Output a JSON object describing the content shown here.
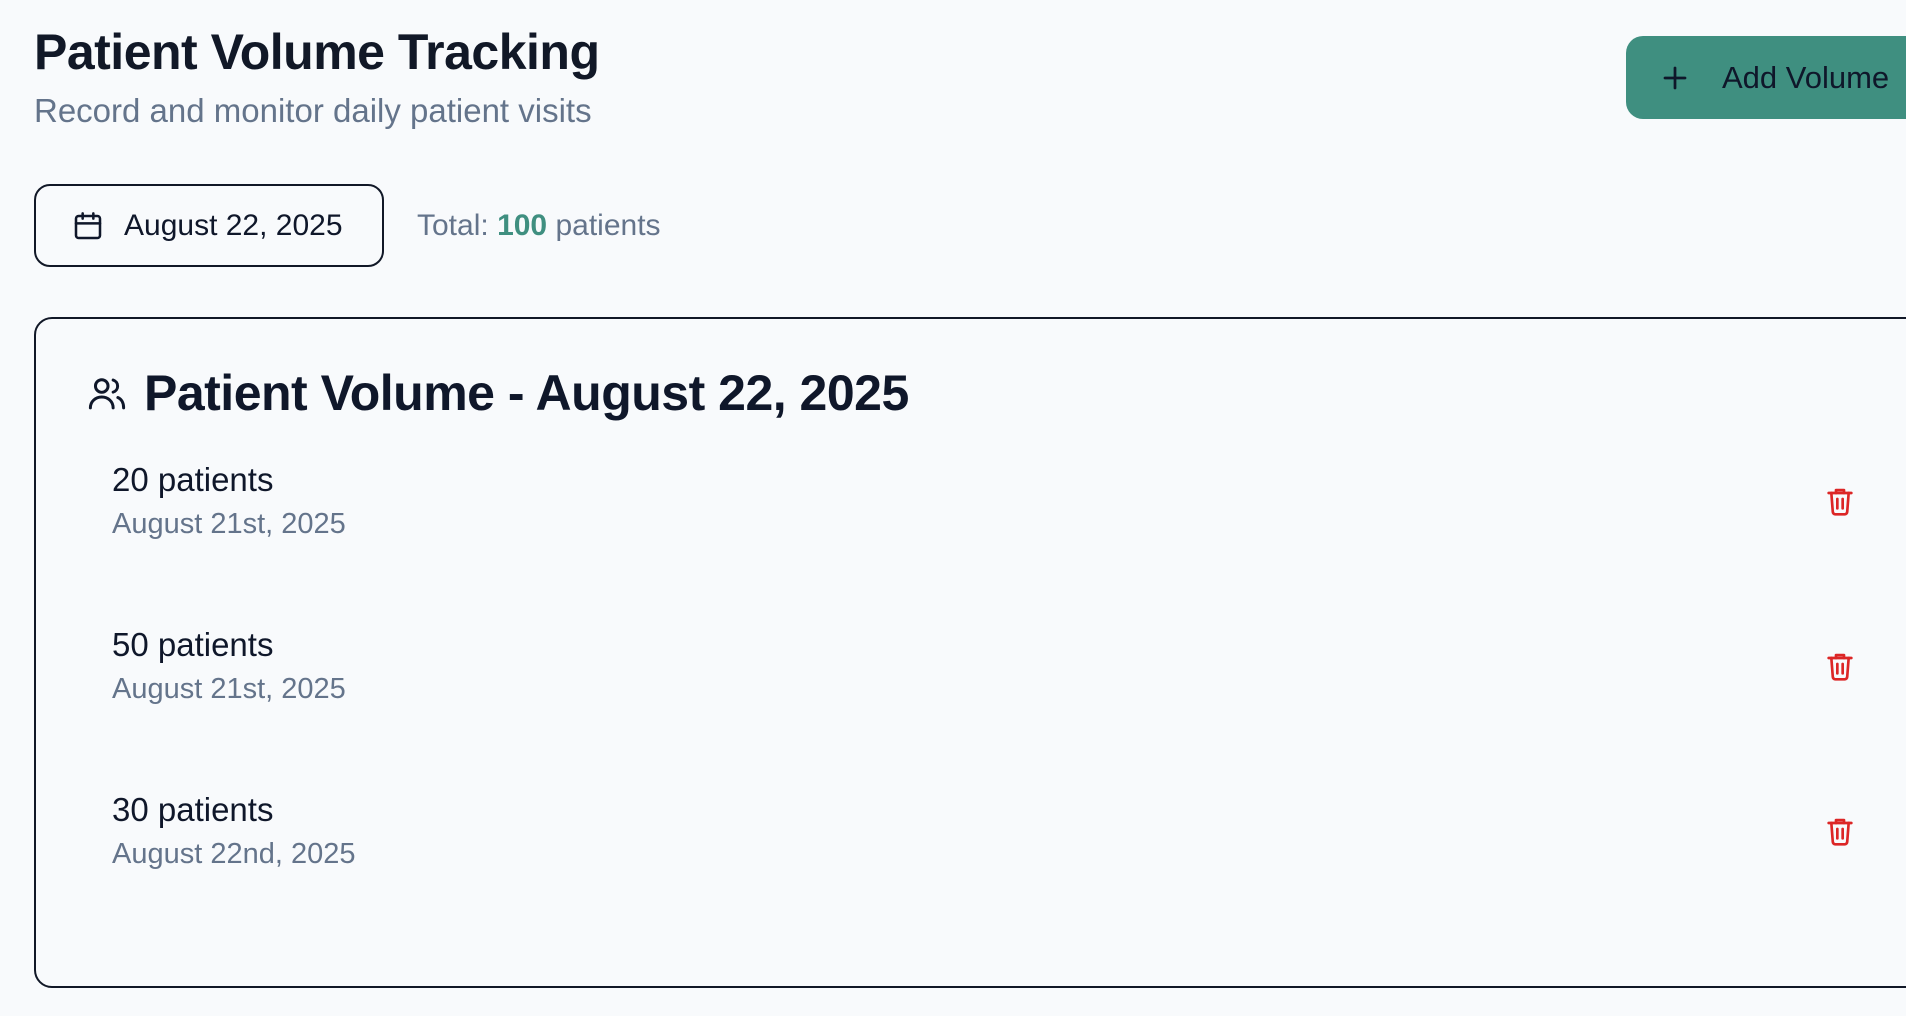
{
  "header": {
    "title": "Patient Volume Tracking",
    "subtitle": "Record and monitor daily patient visits",
    "add_button_label": "Add Volume",
    "add_button_icon": "plus-icon"
  },
  "filter": {
    "selected_date": "August 22, 2025",
    "date_icon": "calendar-icon",
    "total_prefix": "Total:",
    "total_count": "100",
    "total_suffix": "patients"
  },
  "card": {
    "icon": "users-icon",
    "title": "Patient Volume - August 22, 2025",
    "entries": [
      {
        "count": "20 patients",
        "date": "August 21st, 2025"
      },
      {
        "count": "50 patients",
        "date": "August 21st, 2025"
      },
      {
        "count": "30 patients",
        "date": "August 22nd, 2025"
      }
    ],
    "delete_icon": "trash-icon"
  },
  "colors": {
    "accent": "#3f8f80",
    "danger": "#dc2626",
    "muted_text": "#64748b",
    "background": "#f8fafc"
  }
}
